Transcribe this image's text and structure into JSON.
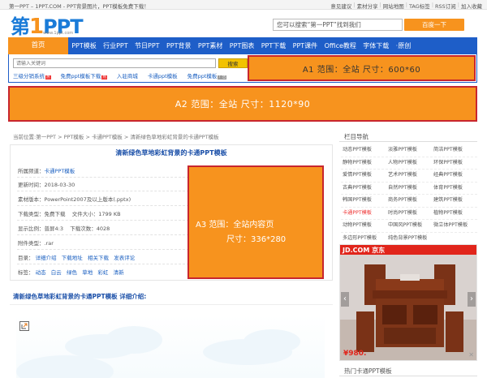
{
  "topbar": {
    "message": "第一PPT – 1PPT.COM - PPT背景图片，PPT模板免费下载！",
    "links": [
      "意见建议",
      "素材分享",
      "网站地图",
      "TAG标签",
      "RSS订阅",
      "加入收藏"
    ]
  },
  "logo": {
    "text_main": "第",
    "text_one": "1",
    "text_ppt": "PPT",
    "url": "www.1ppt.com"
  },
  "search": {
    "placeholder": "您可以搜索“第一PPT”找到我们",
    "button": "百度一下"
  },
  "nav": {
    "home": "首页",
    "items": [
      "PPT模板",
      "行业PPT",
      "节日PPT",
      "PPT背景",
      "PPT素材",
      "PPT图表",
      "PPT下载",
      "PPT课件",
      "Office教程",
      "字体下载",
      "·原创"
    ]
  },
  "subsearch": {
    "placeholder": "请输入关键词",
    "button": "搜索",
    "links": [
      "三级分销系统",
      "免费ppt模板下载",
      "入驻商城",
      "卡通ppt模板",
      "免费ppt模板"
    ],
    "tag": "热",
    "ad_tag": "广告"
  },
  "ads": {
    "a1": "A1  范围：全站 尺寸：600*60",
    "a2": "A2  范围：全站  尺寸：1120*90",
    "a3_line1": "A3  范围：全站内容页",
    "a3_line2": "尺寸：336*280"
  },
  "breadcrumb": "当前位置:第一PPT > PPT模板 > 卡通PPT模板 > 清新绿色草地彩虹背景的卡通PPT模板",
  "info": {
    "title": "清新绿色草地彩虹背景的卡通PPT模板",
    "channel_label": "所属频道：",
    "channel_value": "卡通PPT模板",
    "date_label": "更新时间：",
    "date_value": "2018-03-30",
    "version_label": "素材版本：",
    "version_value": "PowerPoint2007及以上版本(.pptx)",
    "type_label": "下载类型：",
    "type_value": "免费下载",
    "size_label": "文件大小：",
    "size_value": "1799 KB",
    "ratio_label": "显示比例：",
    "ratio_value": "普屏4:3",
    "downloads_label": "下载次数：",
    "downloads_value": "4028",
    "attach_label": "附件类型：",
    "attach_value": ".rar",
    "toc_label": "目录：",
    "toc_items": [
      "详细介绍",
      "下载地址",
      "相关下载",
      "发表评论"
    ],
    "tags_label": "标签：",
    "tags": [
      "动态",
      "白云",
      "绿色",
      "草地",
      "彩虹",
      "清新"
    ]
  },
  "detail_title": "清新绿色草地彩虹背景的卡通PPT模板 详细介绍:",
  "sidebar": {
    "title": "栏目导航",
    "categories": [
      "动态PPT模板",
      "淡雅PPT模板",
      "简洁PPT模板",
      "静物PPT模板",
      "人物PPT模板",
      "环保PPT模板",
      "爱情PPT模板",
      "艺术PPT模板",
      "经典PPT模板",
      "古典PPT模板",
      "自然PPT模板",
      "体育PPT模板",
      "韩国PPT模板",
      "商务PPT模板",
      "建筑PPT模板",
      "卡通PPT模板",
      "时尚PPT模板",
      "植物PPT模板",
      "动物PPT模板",
      "中国风PPT模板",
      "微立体PPT模板",
      "多边形PPT模板",
      "纯色背景PPT模板",
      ""
    ],
    "active_index": 15,
    "jd_brand": "JD.COM 京东",
    "jd_price": "¥980.",
    "hot_title": "热门卡通PPT模板"
  }
}
